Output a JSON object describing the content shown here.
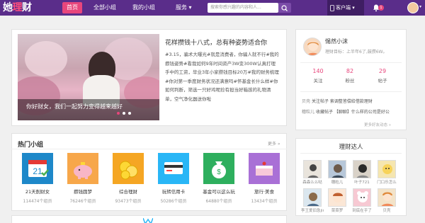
{
  "header": {
    "logo": {
      "part1": "她",
      "part2": "理",
      "part3": "财"
    },
    "nav": [
      {
        "label": "首页",
        "active": true
      },
      {
        "label": "全部小组",
        "active": false
      },
      {
        "label": "我的小组",
        "active": false
      },
      {
        "label": "服务",
        "active": false
      }
    ],
    "service_arrow": "▾",
    "search_placeholder": "搜索你感兴趣的内容和人...",
    "client_label": "客户端",
    "client_arrow": "▾",
    "notification_count": "1",
    "user_arrow": "▾"
  },
  "feature": {
    "caption": "你好财女，我们一起努力变得越来越好",
    "slide_count": 3,
    "active_slide": 1,
    "title": "花样攒钱十八式，总有种姿势适合你",
    "body": "#3.15，骗术大曝光#就是消费者，你骗人就不行#我的攒钱姿势#看我如何9年时间资产3W变300W认真打理手中的工资，毕业3年小家攒钱目标20万#我的财务梳理#你对第一季度财务状况还满意吗#怀基金长什么样#你如何判断，筛选一只好鸡呢捡有担当好箱孩的礼物清单，空气净化器送你啦"
  },
  "groups": {
    "title": "热门小组",
    "more": "更多 »",
    "items": [
      {
        "name": "21天削财女",
        "count": "114474个组员"
      },
      {
        "name": "攒钱圆梦",
        "count": "76246个组员"
      },
      {
        "name": "综合理财",
        "count": "93473个组员"
      },
      {
        "name": "玩转信用卡",
        "count": "50286个组员"
      },
      {
        "name": "基金可以这么玩",
        "count": "64880个组员"
      },
      {
        "name": "旅行·美食",
        "count": "13434个组员"
      }
    ]
  },
  "profile": {
    "name": "惕然小沫",
    "join": "理财目标：上半年6了,鼓攒6W。",
    "stats": [
      {
        "num": "140",
        "label": "关注"
      },
      {
        "num": "82",
        "label": "粉丝"
      },
      {
        "num": "29",
        "label": "帖子"
      }
    ],
    "feed": [
      {
        "user": "贝壳",
        "text": "关注帖子 索调整皆偿给借款理财"
      },
      {
        "user": "穗粒儿",
        "text": "收藏帖子 【聊聊】什么样的公司是好公"
      }
    ],
    "more": "更多好友动态 »"
  },
  "experts": {
    "title": "理财达人",
    "people": [
      {
        "name": "森森么么哒"
      },
      {
        "name": "穗粒儿"
      },
      {
        "name": "叶子721"
      },
      {
        "name": "门口乐怎么"
      },
      {
        "name": "李王爱旧急jimmy"
      },
      {
        "name": "菜菜罗"
      },
      {
        "name": "到底在乎了"
      },
      {
        "name": "贝壳"
      }
    ]
  },
  "colors": {
    "topbar": "#5a2d8a",
    "accent": "#e8467c"
  }
}
